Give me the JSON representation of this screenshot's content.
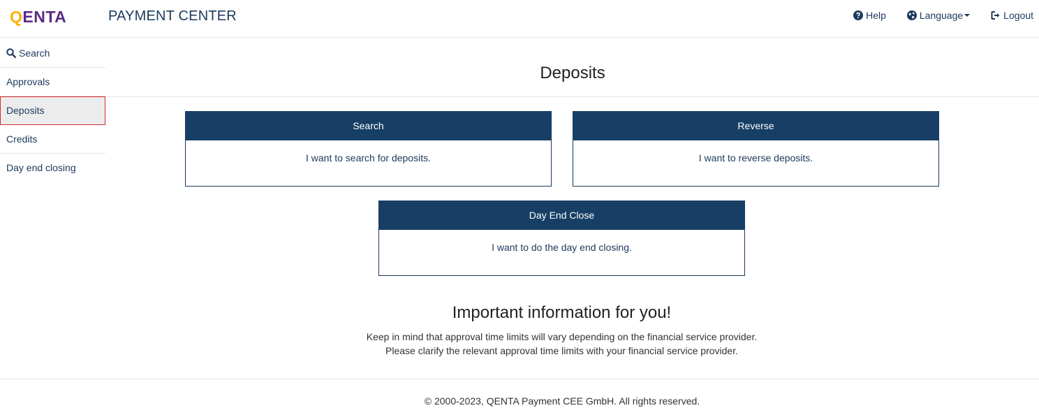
{
  "header": {
    "logo_text": "QENTA",
    "app_title": "PAYMENT CENTER",
    "nav": {
      "help": "Help",
      "language": "Language",
      "logout": "Logout"
    }
  },
  "sidebar": {
    "items": [
      {
        "label": "Search",
        "icon": "search-icon"
      },
      {
        "label": "Approvals"
      },
      {
        "label": "Deposits",
        "active": true
      },
      {
        "label": "Credits"
      },
      {
        "label": "Day end closing"
      }
    ]
  },
  "main": {
    "title": "Deposits",
    "cards": [
      {
        "title": "Search",
        "description": "I want to search for deposits."
      },
      {
        "title": "Reverse",
        "description": "I want to reverse deposits."
      },
      {
        "title": "Day End Close",
        "description": "I want to do the day end closing."
      }
    ],
    "info": {
      "title": "Important information for you!",
      "lines": [
        "Keep in mind that approval time limits will vary depending on the financial service provider.",
        "Please clarify the relevant approval time limits with your financial service provider."
      ]
    }
  },
  "footer": {
    "copyright": "© 2000-2023, QENTA Payment CEE GmbH. All rights reserved."
  },
  "colors": {
    "brand_navy": "#173f66",
    "active_border": "#d9292b",
    "logo_purple": "#5b2a86",
    "logo_yellow": "#f5b400"
  }
}
